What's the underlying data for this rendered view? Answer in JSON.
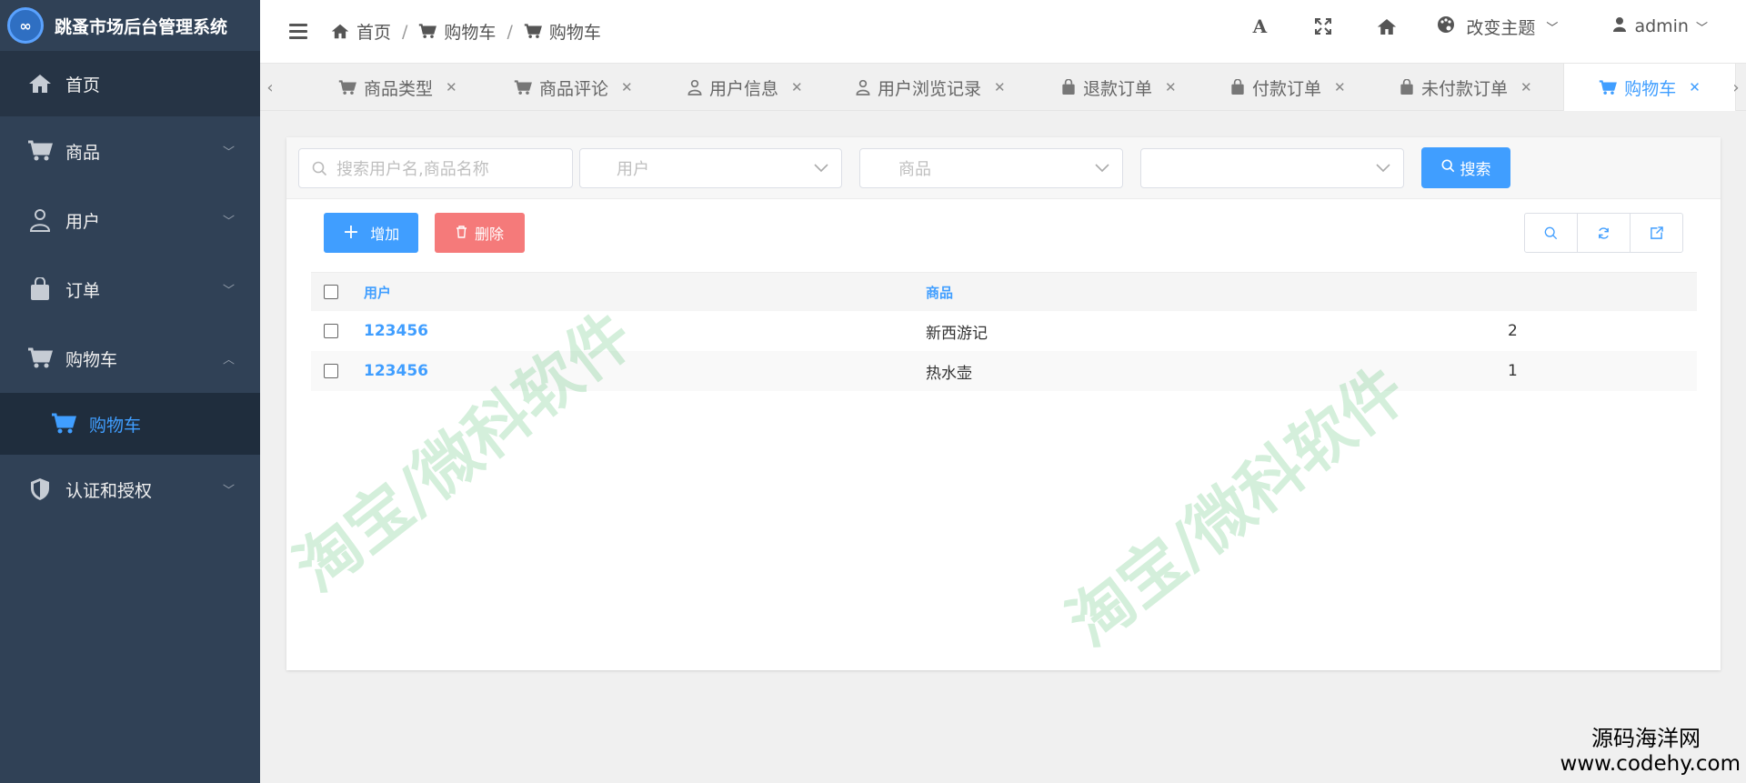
{
  "app": {
    "title": "跳蚤市场后台管理系统"
  },
  "sidebar": {
    "items": [
      {
        "label": "首页",
        "icon": "home-icon"
      },
      {
        "label": "商品",
        "icon": "cart-icon"
      },
      {
        "label": "用户",
        "icon": "user-icon"
      },
      {
        "label": "订单",
        "icon": "bag-icon"
      },
      {
        "label": "购物车",
        "icon": "cart-icon"
      },
      {
        "label": "认证和授权",
        "icon": "shield-icon"
      }
    ],
    "submenu": {
      "label": "购物车",
      "icon": "cart-icon"
    }
  },
  "header": {
    "breadcrumb": [
      "首页",
      "购物车",
      "购物车"
    ],
    "theme_label": "改变主题",
    "user_label": "admin"
  },
  "tabs": [
    {
      "label": "商品类型"
    },
    {
      "label": "商品评论"
    },
    {
      "label": "用户信息"
    },
    {
      "label": "用户浏览记录"
    },
    {
      "label": "退款订单"
    },
    {
      "label": "付款订单"
    },
    {
      "label": "未付款订单"
    },
    {
      "label": "购物车"
    }
  ],
  "filters": {
    "search_placeholder": "搜索用户名,商品名称",
    "user_placeholder": "用户",
    "goods_placeholder": "商品",
    "third_placeholder": "",
    "search_button": "搜索"
  },
  "toolbar": {
    "add_label": "增加",
    "delete_label": "删除"
  },
  "table": {
    "columns": [
      "用户",
      "商品"
    ],
    "rows": [
      {
        "user": "123456",
        "goods": "新西游记",
        "qty": "2"
      },
      {
        "user": "123456",
        "goods": "热水壶",
        "qty": "1"
      }
    ]
  },
  "watermark": {
    "text": "淘宝/微科软件"
  },
  "footer_watermark": {
    "line1": "源码海洋网",
    "line2": "www.codehy.com"
  },
  "colors": {
    "sidebar_bg": "#304156",
    "accent": "#409eff",
    "danger": "#f56c6c"
  }
}
